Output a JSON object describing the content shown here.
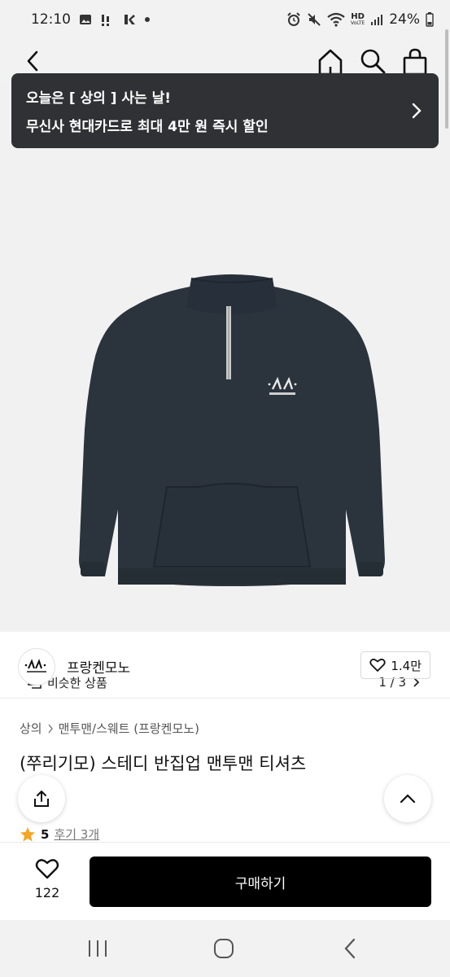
{
  "status_bar": {
    "time": "12:10",
    "network_label": "HD",
    "network_sub": "VoLTE",
    "battery": "24%"
  },
  "header": {
    "back_icon": "chevron-left-icon",
    "home_icon": "home-icon",
    "search_icon": "search-icon",
    "cart_icon": "shopping-bag-icon"
  },
  "promo": {
    "line1": "오늘은 [ 상의 ] 사는 날!",
    "line2": "무신사 현대카드로 최대 4만 원 즉시 할인"
  },
  "image": {
    "similar_label": "비슷한 상품",
    "pager": "1 / 3",
    "garment_color": "#2b343d"
  },
  "brand": {
    "name": "프랑켄모노",
    "likes": "1.4만"
  },
  "breadcrumb": {
    "category": "상의",
    "subcategory": "맨투맨/스웨트 (프랑켄모노)"
  },
  "product": {
    "title": "(쭈리기모) 스테디 반집업 맨투맨 티셔츠",
    "rating": "5",
    "reviews": "후기 3개"
  },
  "action_bar": {
    "wish_count": "122",
    "buy_label": "구매하기"
  },
  "colors": {
    "banner_bg": "#2f3134",
    "buy_bg": "#000000",
    "star": "#f5a623"
  }
}
